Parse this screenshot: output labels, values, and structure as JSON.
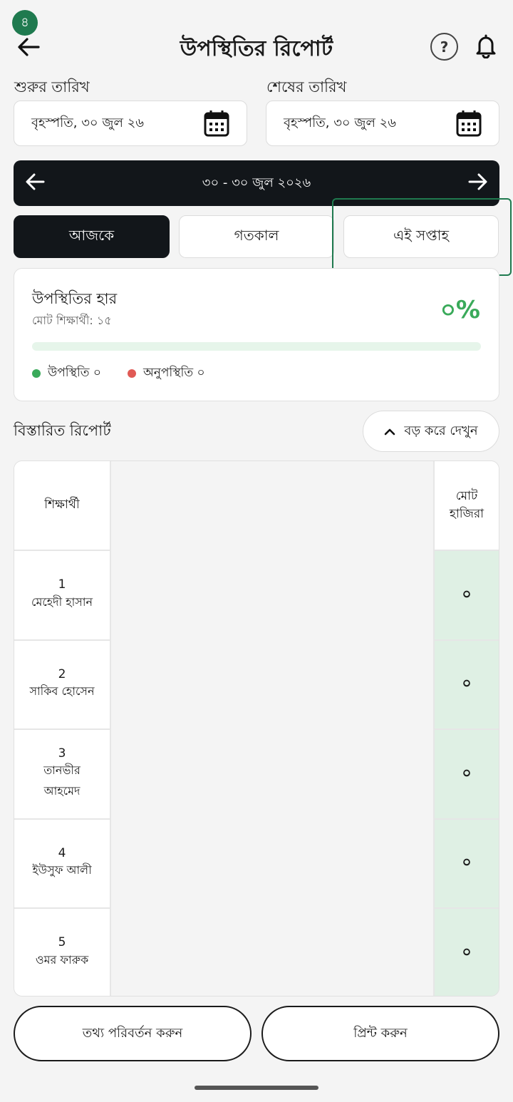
{
  "header": {
    "step_badge": "৪",
    "title": "উপস্থিতির রিপোর্ট",
    "help_symbol": "?"
  },
  "dates": {
    "start_label": "শুরুর তারিখ",
    "start_value": "বৃহস্পতি, ৩০ জুল ২৬",
    "end_label": "শেষের তারিখ",
    "end_value": "বৃহস্পতি, ৩০ জুল ২৬"
  },
  "range": {
    "text": "৩০ - ৩০ জুল ২০২৬"
  },
  "segments": [
    {
      "label": "আজকে",
      "active": true
    },
    {
      "label": "গতকাল",
      "active": false
    },
    {
      "label": "এই সপ্তাহ",
      "active": false
    }
  ],
  "rate_card": {
    "title": "উপস্থিতির হার",
    "subtitle": "মোট শিক্ষার্থী: ১৫",
    "percent": "০%",
    "progress_fraction": 0,
    "present_label": "উপস্থিতি ০",
    "absent_label": "অনুপস্থিতি ০",
    "present_color": "#3aaa5a",
    "absent_color": "#e05a55"
  },
  "detail": {
    "title": "বিস্তারিত রিপোর্ট",
    "expand_label": "বড় করে দেখুন"
  },
  "table": {
    "head_student": "শিক্ষার্থী",
    "head_total_line1": "মোট",
    "head_total_line2": "হাজিরা",
    "rows": [
      {
        "num": "1",
        "name1": "মেহেদী হাসান",
        "name2": "",
        "total": "০"
      },
      {
        "num": "2",
        "name1": "সাকিব হোসেন",
        "name2": "",
        "total": "০"
      },
      {
        "num": "3",
        "name1": "তানভীর",
        "name2": "আহমেদ",
        "total": "০"
      },
      {
        "num": "4",
        "name1": "ইউসুফ আলী",
        "name2": "",
        "total": "০"
      },
      {
        "num": "5",
        "name1": "ওমর ফারুক",
        "name2": "",
        "total": "০"
      }
    ]
  },
  "footer": {
    "edit_label": "তথ্য পরিবর্তন করুন",
    "print_label": "প্রিন্ট করুন"
  }
}
